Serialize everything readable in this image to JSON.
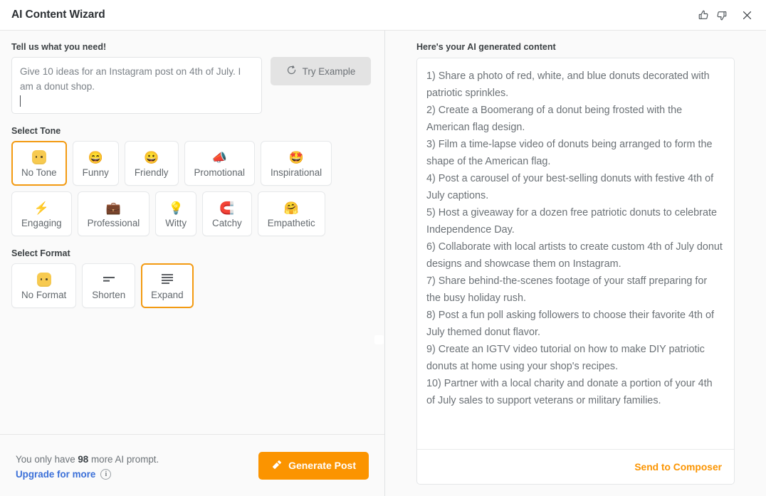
{
  "header": {
    "title": "AI Content Wizard",
    "actions": [
      {
        "name": "thumbs-up-icon",
        "label": "Thumbs up"
      },
      {
        "name": "thumbs-down-icon",
        "label": "Thumbs down"
      },
      {
        "name": "close-icon",
        "label": "Close"
      }
    ]
  },
  "colors": {
    "accent": "#fb9400",
    "selected_border": "#f39a11",
    "link": "#3a6fd8",
    "panel_bg": "#fafafa",
    "card_bg": "#ffffff",
    "text": "#6b7176"
  },
  "left": {
    "prompt_label": "Tell us what you need!",
    "prompt_value": "Give 10 ideas for an Instagram post on 4th of July. I am a donut shop.",
    "prompt_placeholder": "Tell us what you need!",
    "try_example_label": "Try Example",
    "try_example_icon": "refresh-icon",
    "tone_label": "Select Tone",
    "tones": [
      {
        "label": "No Tone",
        "icon": "expressionless-face-emoji",
        "glyph": "",
        "selected": true
      },
      {
        "label": "Funny",
        "icon": "grinning-squinting-face-emoji",
        "glyph": "😄",
        "selected": false
      },
      {
        "label": "Friendly",
        "icon": "grinning-face-emoji",
        "glyph": "😀",
        "selected": false
      },
      {
        "label": "Promotional",
        "icon": "megaphone-emoji",
        "glyph": "📣",
        "selected": false
      },
      {
        "label": "Inspirational",
        "icon": "star-struck-emoji",
        "glyph": "🤩",
        "selected": false
      },
      {
        "label": "Engaging",
        "icon": "high-voltage-emoji",
        "glyph": "⚡",
        "selected": false
      },
      {
        "label": "Professional",
        "icon": "briefcase-emoji",
        "glyph": "💼",
        "selected": false
      },
      {
        "label": "Witty",
        "icon": "light-bulb-emoji",
        "glyph": "💡",
        "selected": false
      },
      {
        "label": "Catchy",
        "icon": "magnet-emoji",
        "glyph": "🧲",
        "selected": false
      },
      {
        "label": "Empathetic",
        "icon": "hugging-face-emoji",
        "glyph": "🤗",
        "selected": false
      }
    ],
    "format_label": "Select Format",
    "formats": [
      {
        "label": "No Format",
        "icon": "expressionless-face-emoji",
        "selected": false
      },
      {
        "label": "Shorten",
        "icon": "shorten-lines-icon",
        "selected": false
      },
      {
        "label": "Expand",
        "icon": "expand-lines-icon",
        "selected": true
      }
    ],
    "footer": {
      "quota_prefix": "You only have ",
      "quota_count": "98",
      "quota_suffix": " more AI prompt.",
      "upgrade_label": "Upgrade for more",
      "info_glyph": "i",
      "generate_label": "Generate Post",
      "generate_icon": "magic-wand-icon"
    }
  },
  "right": {
    "label": "Here's your AI generated content",
    "content": "1) Share a photo of red, white, and blue donuts decorated with patriotic sprinkles.\n2) Create a Boomerang of a donut being frosted with the American flag design.\n3) Film a time-lapse video of donuts being arranged to form the shape of the American flag.\n4) Post a carousel of your best-selling donuts with festive 4th of July captions.\n5) Host a giveaway for a dozen free patriotic donuts to celebrate Independence Day.\n6) Collaborate with local artists to create custom 4th of July donut designs and showcase them on Instagram.\n7) Share behind-the-scenes footage of your staff preparing for the busy holiday rush.\n8) Post a fun poll asking followers to choose their favorite 4th of July themed donut flavor.\n9) Create an IGTV video tutorial on how to make DIY patriotic donuts at home using your shop's recipes.\n10) Partner with a local charity and donate a portion of your 4th of July sales to support veterans or military families.",
    "send_label": "Send to Composer"
  }
}
